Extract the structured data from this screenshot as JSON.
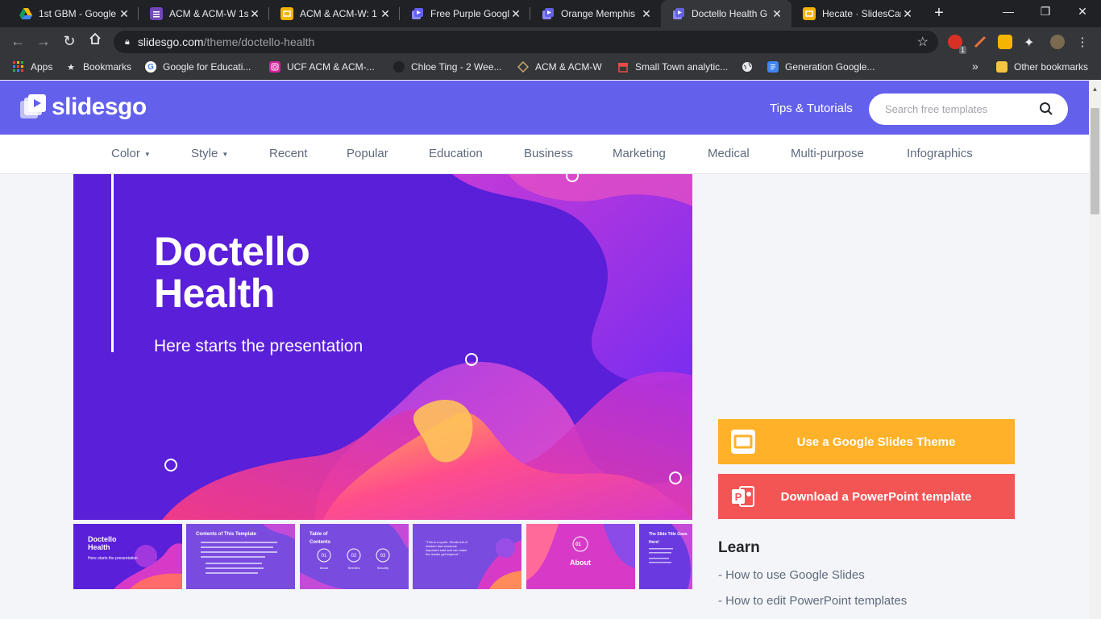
{
  "browser": {
    "tabs": [
      {
        "title": "1st GBM - Google",
        "icon": "google-drive-icon",
        "color": "#fbbc04",
        "active": false
      },
      {
        "title": "ACM & ACM-W 1s",
        "icon": "google-forms-icon",
        "color": "#7248b9",
        "active": false
      },
      {
        "title": "ACM & ACM-W: 1",
        "icon": "google-slides-icon",
        "color": "#f4b400",
        "active": false
      },
      {
        "title": "Free Purple Googl",
        "icon": "slidesgo-icon",
        "color": "#6360ec",
        "active": false
      },
      {
        "title": "Orange Memphis",
        "icon": "slidesgo-icon",
        "color": "#6360ec",
        "active": false
      },
      {
        "title": "Doctello Health G",
        "icon": "slidesgo-icon",
        "color": "#6360ec",
        "active": true
      },
      {
        "title": "Hecate · SlidesCarn",
        "icon": "google-slides-icon",
        "color": "#f4b400",
        "active": false
      }
    ],
    "url_host": "slidesgo.com",
    "url_path": "/theme/doctello-health",
    "extension_badge": "1",
    "bookmarks": [
      {
        "label": "Apps",
        "icon": "apps-grid-icon"
      },
      {
        "label": "Bookmarks",
        "icon": "star-icon"
      },
      {
        "label": "Google for Educati...",
        "icon": "google-icon"
      },
      {
        "label": "UCF ACM & ACM-...",
        "icon": "instagram-icon"
      },
      {
        "label": "Chloe Ting - 2 Wee...",
        "icon": "profile-icon"
      },
      {
        "label": "ACM & ACM-W",
        "icon": "diamond-icon"
      },
      {
        "label": "Small Town analytic...",
        "icon": "shop-icon"
      },
      {
        "label": "",
        "icon": "globe-icon"
      },
      {
        "label": "Generation Google...",
        "icon": "google-docs-icon"
      }
    ],
    "more_bookmarks": "»",
    "other_bookmarks": "Other bookmarks"
  },
  "site": {
    "logo_text": "slidesgo",
    "tips_link": "Tips & Tutorials",
    "search_placeholder": "Search free templates",
    "categories": [
      "Color",
      "Style",
      "Recent",
      "Popular",
      "Education",
      "Business",
      "Marketing",
      "Medical",
      "Multi-purpose",
      "Infographics"
    ]
  },
  "hero": {
    "title_line1": "Doctello",
    "title_line2": "Health",
    "subtitle": "Here starts the presentation"
  },
  "thumbnails": [
    {
      "label": "Doctello Health",
      "sub": "Here starts the presentation"
    },
    {
      "label": "Contents of This Template",
      "sub": ""
    },
    {
      "label": "Table of Contents",
      "sub": ""
    },
    {
      "label": "\"This is a quote. Words full of wisdom that someone important said and can make the reader get inspired.\"",
      "sub": ""
    },
    {
      "label": "About",
      "sub": "01"
    },
    {
      "label": "The Slide Title Goes Here!",
      "sub": ""
    }
  ],
  "sidebar": {
    "google_button": "Use a Google Slides Theme",
    "ppt_button": "Download a PowerPoint template",
    "learn_heading": "Learn",
    "learn_links": [
      "- How to use Google Slides",
      "- How to edit PowerPoint templates"
    ]
  },
  "colors": {
    "brand": "#6360ec",
    "google_button": "#ffb129",
    "ppt_button": "#f35454"
  }
}
